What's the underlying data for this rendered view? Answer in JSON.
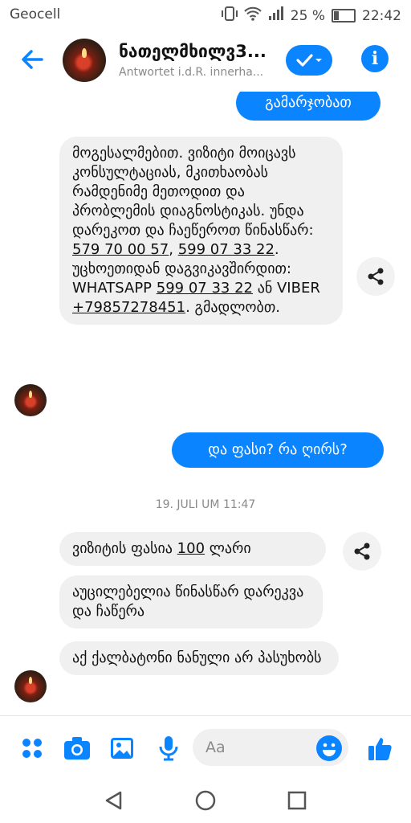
{
  "status": {
    "carrier": "Geocell",
    "battery": "25 %",
    "battery_level": 0.25,
    "time": "22:42"
  },
  "header": {
    "title": "ნათელმხილვ3...",
    "subtitle": "Antwortet i.d.R. innerha...",
    "icons": {
      "back": "arrow-left-icon",
      "check": "check-dropdown-icon",
      "info": "info-icon"
    }
  },
  "messages": {
    "m1": "გამარჯობათ",
    "m2": {
      "intro": "მოგესალმებით. ვიზიტი მოიცავს კონსულტაციას, მკითხაობას რამდენიმე მეთოდით და პრობლემის დიაგნოსტიკას. უნდა დარეკოთ და ჩაეწეროთ წინასწარ: ",
      "phone1": "579 70 00 57",
      "comma": ", ",
      "phone2": "599 07 33 22",
      "mid": ". უცხოეთიდან დაგვიკავშირდით: WHATSAPP ",
      "phone3": "599 07 33 22",
      "and": " ან VIBER ",
      "phone4": "+79857278451",
      "end": ". გმადლობთ."
    },
    "m3": "და ფასი? რა ღირს?",
    "timestamp": "19. JULI UM 11:47",
    "m4": {
      "before": "ვიზიტის ფასია ",
      "price": "100",
      "after": " ლარი"
    },
    "m5": "აუცილებელია წინასწარ დარეკვა და ჩაწერა",
    "m6": "აქ ქალბატონი ნანული არ პასუხობს"
  },
  "composer": {
    "placeholder": "Aa"
  }
}
